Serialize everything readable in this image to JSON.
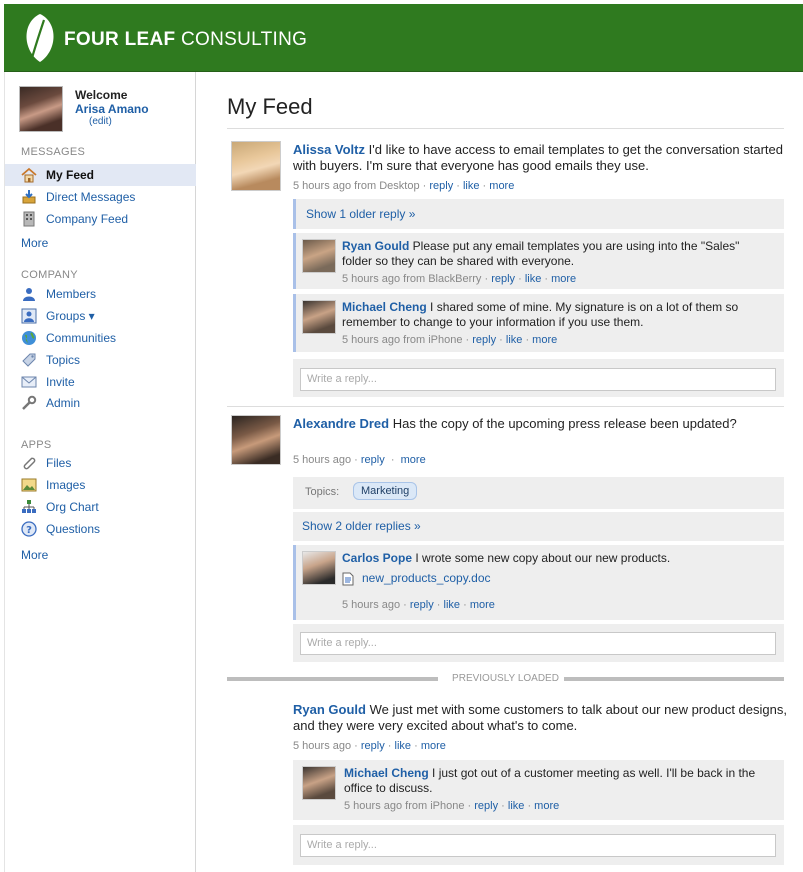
{
  "brand": {
    "name_bold": "FOUR LEAF",
    "name_light": "CONSULTING",
    "color": "#2f7a1f"
  },
  "user": {
    "welcome": "Welcome",
    "name": "Arisa Amano",
    "edit": "(edit)"
  },
  "sidebar": {
    "messages_heading": "MESSAGES",
    "messages": [
      {
        "label": "My Feed",
        "icon": "home-icon",
        "active": true
      },
      {
        "label": "Direct Messages",
        "icon": "inbox-icon"
      },
      {
        "label": "Company Feed",
        "icon": "building-icon"
      }
    ],
    "messages_more": "More",
    "company_heading": "COMPANY",
    "company": [
      {
        "label": "Members",
        "icon": "person-icon"
      },
      {
        "label": "Groups ▾",
        "icon": "group-icon"
      },
      {
        "label": "Communities",
        "icon": "globe-icon"
      },
      {
        "label": "Topics",
        "icon": "tag-icon"
      },
      {
        "label": "Invite",
        "icon": "envelope-icon"
      },
      {
        "label": "Admin",
        "icon": "wrench-icon"
      }
    ],
    "apps_heading": "APPS",
    "apps": [
      {
        "label": "Files",
        "icon": "paperclip-icon"
      },
      {
        "label": "Images",
        "icon": "image-icon"
      },
      {
        "label": "Org Chart",
        "icon": "org-chart-icon"
      },
      {
        "label": "Questions",
        "icon": "question-icon"
      }
    ],
    "apps_more": "More"
  },
  "main": {
    "title": "My Feed",
    "reply_placeholder": "Write a reply...",
    "previously_loaded": "PREVIOUSLY LOADED",
    "posts": [
      {
        "author": "Alissa Voltz",
        "text": " I'd like to have access to email templates to get the conversation started with buyers. I'm sure that everyone has good emails they use.",
        "meta": "5 hours ago from Desktop ·",
        "show_older": "Show 1 older reply »",
        "replies": [
          {
            "author": "Ryan Gould",
            "text": " Please put any email templates you are using into the \"Sales\" folder so they can be shared with everyone.",
            "meta": "5 hours ago from BlackBerry ·"
          },
          {
            "author": "Michael Cheng",
            "text": " I shared some of mine. My signature is on a lot of them so remember to change to your information if you use them.",
            "meta": "5 hours ago from iPhone ·"
          }
        ]
      },
      {
        "author": "Alexandre Dred",
        "text": " Has the copy of the upcoming press release been updated?",
        "meta": "5 hours ago ·",
        "topics_label": "Topics:",
        "topic": "Marketing",
        "show_older": "Show 2 older replies »",
        "replies": [
          {
            "author": "Carlos Pope",
            "text": " I wrote some new copy about our new products.",
            "file": "new_products_copy.doc",
            "meta": "5 hours ago ·"
          }
        ]
      },
      {
        "author": "Ryan Gould",
        "text": " We just met with some customers to talk about our new product designs, and they were very excited about what's to come.",
        "meta": "5 hours ago ·",
        "replies": [
          {
            "author": "Michael Cheng",
            "text": " I just got out of a customer meeting as well. I'll be back in the office to discuss.",
            "meta": "5 hours ago from iPhone ·"
          }
        ]
      }
    ],
    "actions": {
      "reply": "reply",
      "like": "like",
      "more": "more",
      "sep": " · "
    }
  }
}
